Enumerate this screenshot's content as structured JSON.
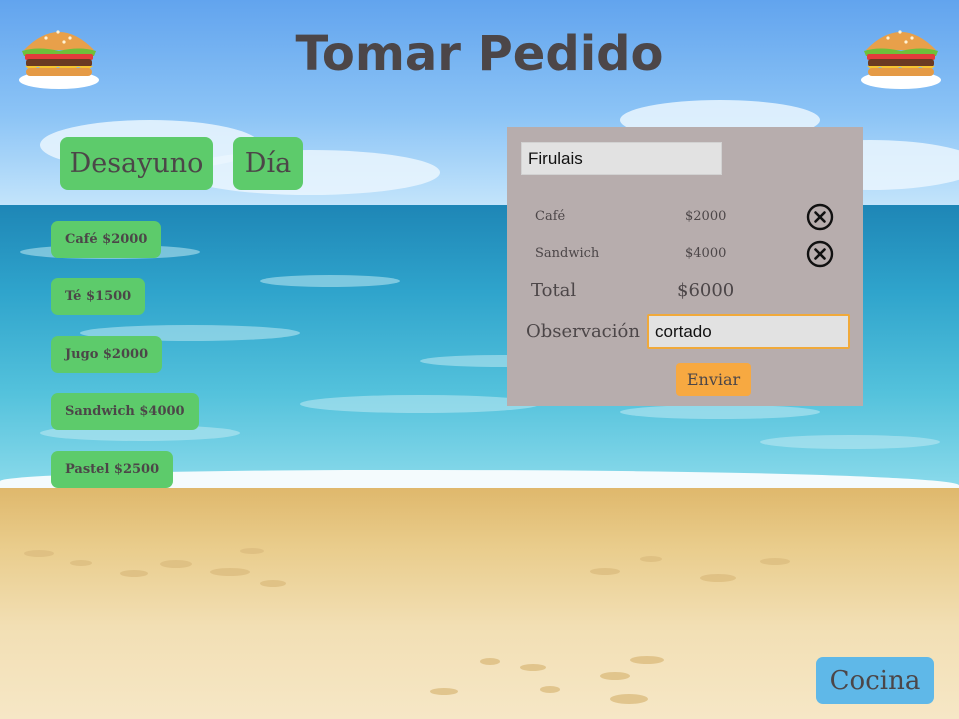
{
  "header": {
    "title": "Tomar Pedido",
    "left_icon": "burger-icon",
    "right_icon": "burger-icon"
  },
  "categories": [
    {
      "label": "Desayuno"
    },
    {
      "label": "Día"
    }
  ],
  "menu_items": [
    {
      "label": "Café $2000"
    },
    {
      "label": "Té $1500"
    },
    {
      "label": "Jugo $2000"
    },
    {
      "label": "Sandwich $4000"
    },
    {
      "label": "Pastel $2500"
    }
  ],
  "order": {
    "customer_name": "Firulais",
    "items": [
      {
        "name": "Café",
        "price": "$2000",
        "remove_icon": "remove-circle-icon"
      },
      {
        "name": "Sandwich",
        "price": "$4000",
        "remove_icon": "remove-circle-icon"
      }
    ],
    "total_label": "Total",
    "total_value": "$6000",
    "observation_label": "Observación",
    "observation_value": "cortado",
    "send_label": "Enviar"
  },
  "footer": {
    "kitchen_label": "Cocina"
  },
  "colors": {
    "button_green": "#5dcb6b",
    "panel_bg": "#b7adad",
    "send_orange": "#f7a941",
    "kitchen_blue": "#5fb8e8",
    "text_dark": "#4c4648"
  }
}
